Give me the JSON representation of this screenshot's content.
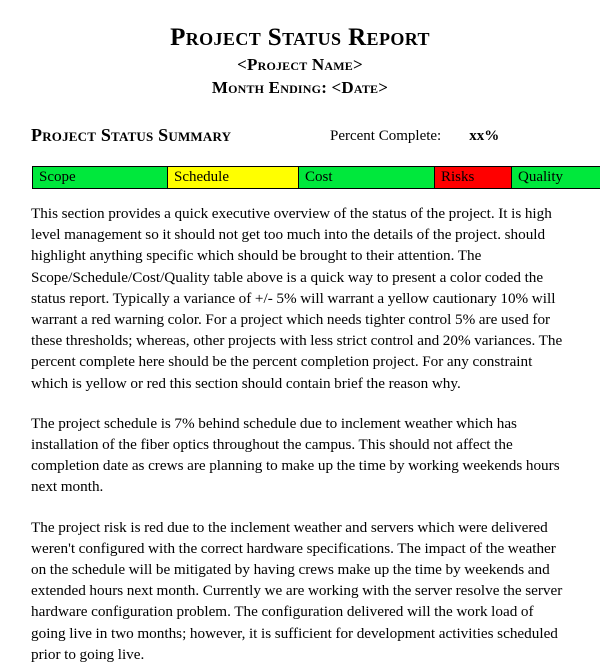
{
  "document": {
    "title": "Project Status Report",
    "subtitle_project": "<Project Name>",
    "subtitle_month": "Month Ending: <Date>"
  },
  "summary": {
    "heading": "Project Status Summary",
    "percent_complete_label": "Percent Complete:",
    "percent_complete_value": "xx%"
  },
  "status_table": {
    "cells": [
      {
        "label": "Scope",
        "color": "#00E83C",
        "status": "green"
      },
      {
        "label": "Schedule",
        "color": "#FFFF00",
        "status": "yellow"
      },
      {
        "label": "Cost",
        "color": "#00E83C",
        "status": "green"
      },
      {
        "label": "Risks",
        "color": "#FF0000",
        "status": "red"
      },
      {
        "label": "Quality",
        "color": "#00E83C",
        "status": "green"
      }
    ]
  },
  "body": {
    "paragraphs": [
      "This section provides a quick executive overview of the status of the project.  It is high level management so it should not get too much into the details of the project. should highlight anything specific which should be brought to their attention.  The Scope/Schedule/Cost/Quality table above is a quick way to present a color coded the status report.  Typically a variance of +/- 5% will warrant a yellow cautionary 10% will warrant a red warning color.  For a project which needs tighter control 5% are used for these thresholds; whereas, other projects with less strict control and 20% variances.  The percent complete here should be the percent completion project.  For any constraint which is yellow or red this section should contain brief the reason why.",
      "The project schedule is 7% behind schedule due to inclement weather which has installation of the fiber optics throughout the campus.  This should not affect the completion date as crews are planning to make up the time by working weekends hours next month.",
      "The project risk is red due to the inclement weather and servers which were delivered weren't configured with the correct hardware specifications.  The impact of the weather on the schedule will be mitigated by having crews make up the time by weekends and extended hours next month.  Currently we are working with the server resolve the server hardware configuration problem.  The configuration delivered will the work load of going live in two months; however, it is sufficient for development activities scheduled prior to going live."
    ]
  }
}
